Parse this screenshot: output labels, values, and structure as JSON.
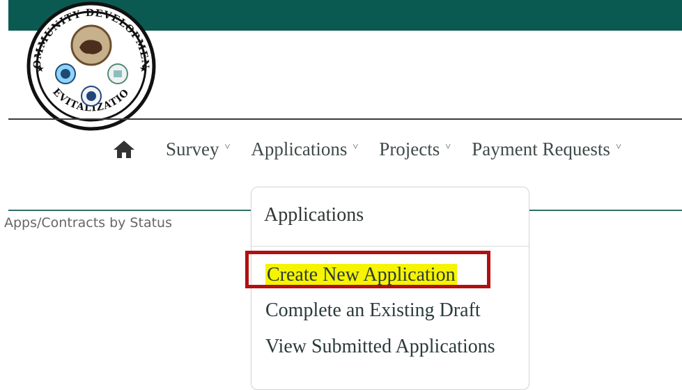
{
  "logo": {
    "text_top": "COMMUNITY DEVELOPMENT",
    "text_bottom": "REVITALIZATION"
  },
  "nav": {
    "home_icon": "home-icon",
    "items": [
      {
        "label": "Survey",
        "caret": "˅"
      },
      {
        "label": "Applications",
        "caret": "˅"
      },
      {
        "label": "Projects",
        "caret": "˅"
      },
      {
        "label": "Payment Requests",
        "caret": "˅"
      }
    ]
  },
  "breadcrumb": {
    "text": "Apps/Contracts by Status"
  },
  "dropdown": {
    "header": "Applications",
    "items": [
      {
        "label": "Create New Application"
      },
      {
        "label": "Complete an Existing Draft"
      },
      {
        "label": "View Submitted Applications"
      }
    ]
  },
  "colors": {
    "topbar": "#0a5a52",
    "highlight": "#f6f400",
    "callout": "#b10f12"
  }
}
